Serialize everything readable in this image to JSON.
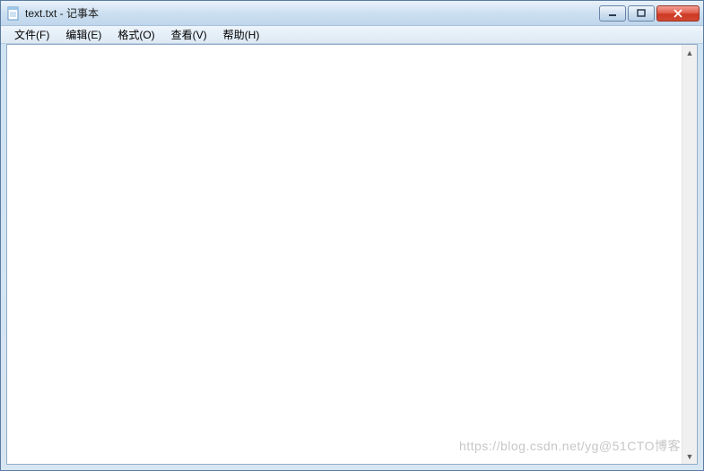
{
  "window": {
    "title": "text.txt - 记事本"
  },
  "menu": {
    "file": "文件(F)",
    "edit": "编辑(E)",
    "format": "格式(O)",
    "view": "查看(V)",
    "help": "帮助(H)"
  },
  "editor": {
    "value": "",
    "placeholder": ""
  },
  "watermark": "https://blog.csdn.net/yg@51CTO博客"
}
